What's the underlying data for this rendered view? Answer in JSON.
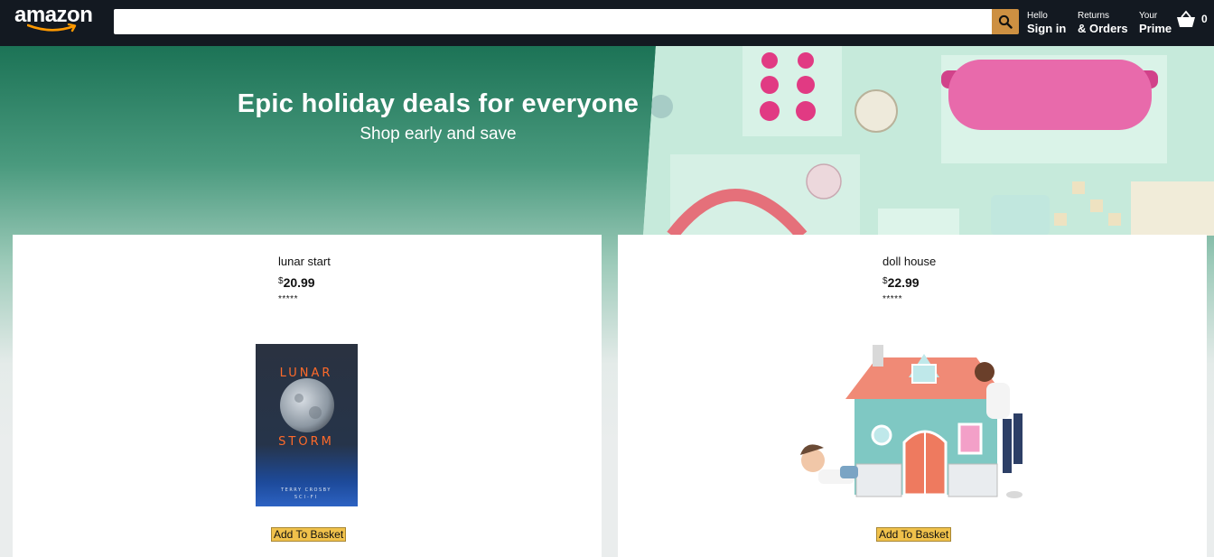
{
  "header": {
    "logo_text": "amazon",
    "search": {
      "value": "",
      "placeholder": ""
    },
    "signin": {
      "line1": "Hello",
      "line2": "Sign in"
    },
    "orders": {
      "line1": "Returns",
      "line2": "& Orders"
    },
    "prime": {
      "line1": "Your",
      "line2": "Prime"
    },
    "basket_count": "0"
  },
  "banner": {
    "title": "Epic holiday deals for everyone",
    "subtitle": "Shop early and save"
  },
  "book_cover": {
    "title_line1": "LUNAR",
    "title_line2": "STORM",
    "author": "TERRY CROSBY",
    "genre": "SCI-FI"
  },
  "products": [
    {
      "title": "lunar start",
      "currency": "$",
      "price": "20.99",
      "rating": "*****",
      "button": "Add To Basket"
    },
    {
      "title": "doll house",
      "currency": "$",
      "price": "22.99",
      "rating": "*****",
      "button": "Add To Basket"
    }
  ],
  "colors": {
    "header_bg": "#131921",
    "search_button": "#cd9042",
    "add_button": "#f0c14b",
    "banner_top": "#1c7356"
  }
}
